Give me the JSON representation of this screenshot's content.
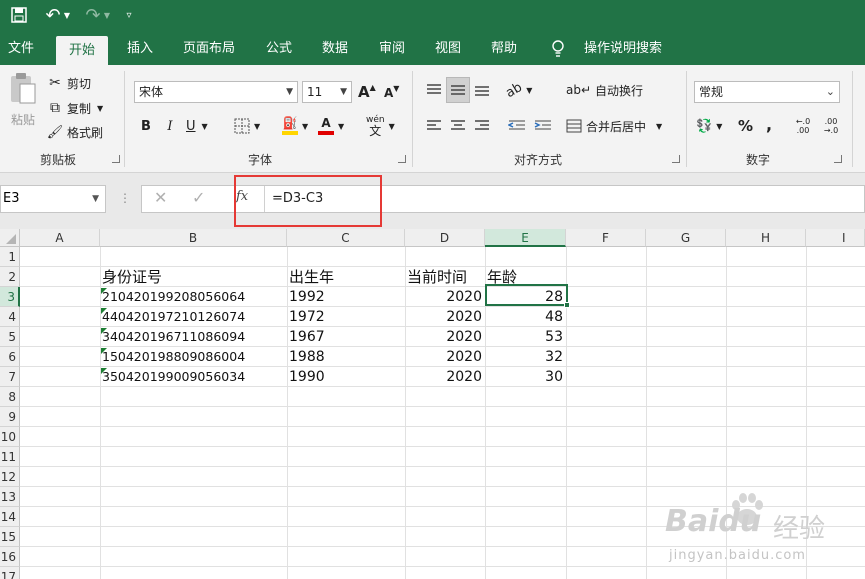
{
  "ribbon_tabs": [
    "文件",
    "开始",
    "插入",
    "页面布局",
    "公式",
    "数据",
    "审阅",
    "视图",
    "帮助"
  ],
  "active_tab": "开始",
  "tell_me": "操作说明搜索",
  "clipboard": {
    "paste": "粘贴",
    "cut": "剪切",
    "copy": "复制",
    "format_painter": "格式刷",
    "label": "剪贴板"
  },
  "font": {
    "name": "宋体",
    "size": "11",
    "bold": "B",
    "italic": "I",
    "underline": "U",
    "grow": "A",
    "shrink": "A",
    "phonetic": "wén",
    "label": "字体"
  },
  "alignment": {
    "wrap": "自动换行",
    "merge": "合并后居中",
    "label": "对齐方式"
  },
  "number": {
    "format": "常规",
    "percent": "%",
    "comma": ",",
    "inc_decimal": "←.0 .00",
    "dec_decimal": ".00 →.0",
    "label": "数字"
  },
  "formula_bar": {
    "name_box": "E3",
    "fx": "fx",
    "formula": "=D3-C3"
  },
  "columns": [
    "A",
    "B",
    "C",
    "D",
    "E",
    "F",
    "G",
    "H",
    "I"
  ],
  "rows": [
    "1",
    "2",
    "3",
    "4",
    "5",
    "6",
    "7",
    "8",
    "9",
    "10",
    "11",
    "12",
    "13",
    "14",
    "15",
    "16",
    "17"
  ],
  "sheet": {
    "headers": [
      "身份证号",
      "出生年",
      "当前时间",
      "年龄"
    ],
    "data": [
      [
        "210420199208056064",
        "1992",
        "2020",
        "28"
      ],
      [
        "440420197210126074",
        "1972",
        "2020",
        "48"
      ],
      [
        "340420196711086094",
        "1967",
        "2020",
        "53"
      ],
      [
        "150420198809086004",
        "1988",
        "2020",
        "32"
      ],
      [
        "350420199009056034",
        "1990",
        "2020",
        "30"
      ]
    ]
  },
  "watermark": {
    "brand": "Baidu",
    "cn": "经验",
    "url": "jingyan.baidu.com"
  },
  "colors": {
    "accent": "#217346",
    "highlight_box": "#e53935",
    "fill_color": "#ffd500",
    "font_color": "#e00000"
  }
}
